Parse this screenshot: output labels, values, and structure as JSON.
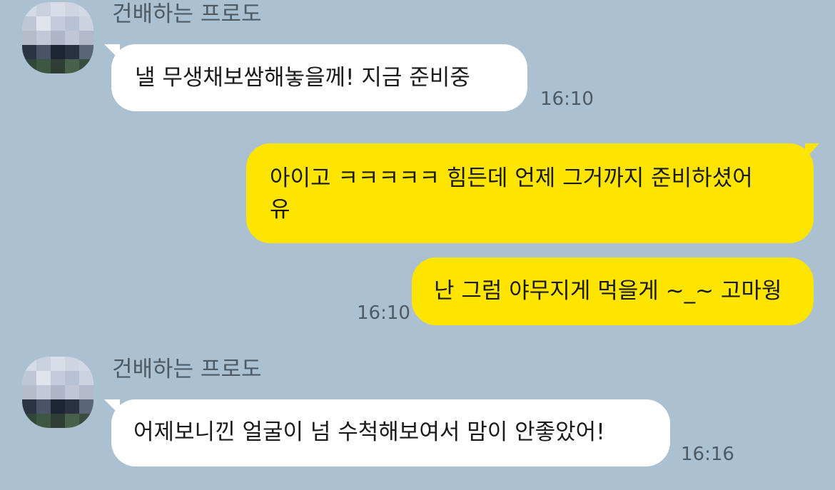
{
  "messages": [
    {
      "direction": "incoming",
      "sender": "건배하는 프로도",
      "text": "낼  무생채보쌈해놓을께!  지금 준비중",
      "time": "16:10"
    },
    {
      "direction": "outgoing",
      "lines": [
        "아이고 ㅋㅋㅋㅋㅋ 힘든데 언제 그거까지 준비하셨어",
        "유"
      ]
    },
    {
      "direction": "outgoing",
      "text": "난 그럼 야무지게 먹을게 ~_~ 고마웡",
      "time": "16:10"
    },
    {
      "direction": "incoming",
      "sender": "건배하는 프로도",
      "text": "어제보니낀 얼굴이 넘 수척해보여서  맘이 안좋았어!",
      "time": "16:16"
    }
  ],
  "colors": {
    "background": "#abc1d1",
    "incoming_bubble": "#ffffff",
    "outgoing_bubble": "#fee500",
    "meta_text": "#4f5a63"
  },
  "avatar": {
    "icon": "pixelated-avatar-icon"
  }
}
